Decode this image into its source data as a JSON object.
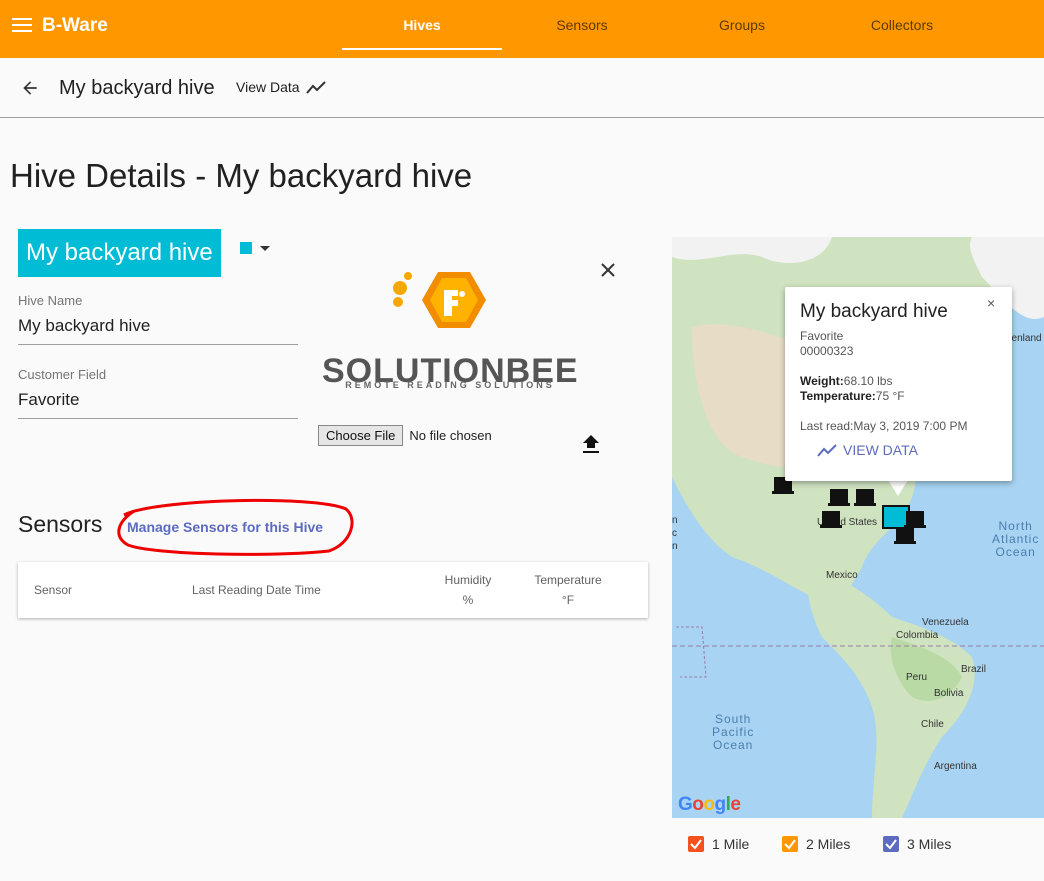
{
  "app": {
    "brand": "B-Ware"
  },
  "nav": {
    "tabs": [
      {
        "label": "Hives"
      },
      {
        "label": "Sensors"
      },
      {
        "label": "Groups"
      },
      {
        "label": "Collectors"
      }
    ]
  },
  "subbar": {
    "title": "My backyard hive",
    "view_data": "View Data"
  },
  "page": {
    "title": "Hive Details - My backyard hive"
  },
  "hive": {
    "chip_name": "My backyard hive",
    "color": "#00bcd4",
    "name_label": "Hive Name",
    "name_value": "My backyard hive",
    "customer_label": "Customer Field",
    "customer_value": "Favorite"
  },
  "logo": {
    "text": "SOLUTIONBEE",
    "tagline": "REMOTE READING SOLUTIONS"
  },
  "file": {
    "button": "Choose File",
    "status": "No file chosen"
  },
  "sensors": {
    "heading": "Sensors",
    "manage_link": "Manage Sensors for this Hive",
    "columns": [
      {
        "label": "Sensor",
        "unit": ""
      },
      {
        "label": "Last Reading Date Time",
        "unit": ""
      },
      {
        "label": "Humidity",
        "unit": "%"
      },
      {
        "label": "Temperature",
        "unit": "°F"
      }
    ]
  },
  "map": {
    "labels": {
      "united_states": "United States",
      "mexico": "Mexico",
      "venezuela": "Venezuela",
      "colombia": "Colombia",
      "peru": "Peru",
      "brazil": "Brazil",
      "bolivia": "Bolivia",
      "chile": "Chile",
      "argentina": "Argentina",
      "greenland_partial": "eenland",
      "north_atlantic": "North\nAtlantic\nOcean",
      "south_pacific": "South\nPacific\nOcean",
      "edge_n": "n",
      "edge_c": "c",
      "edge_n2": "n"
    },
    "google": "Google",
    "popup": {
      "title": "My backyard hive",
      "close": "×",
      "customer": "Favorite",
      "id": "00000323",
      "weight_label": "Weight:",
      "weight_value": "68.10 lbs",
      "temp_label": "Temperature:",
      "temp_value": "75 °F",
      "last_read_label": "Last read:",
      "last_read_value": "May 3, 2019 7:00 PM",
      "view_data": "VIEW DATA"
    }
  },
  "legend": [
    {
      "label": "1 Mile",
      "color": "#f4511e"
    },
    {
      "label": "2 Miles",
      "color": "#ff9800"
    },
    {
      "label": "3 Miles",
      "color": "#5c6bc0"
    }
  ]
}
